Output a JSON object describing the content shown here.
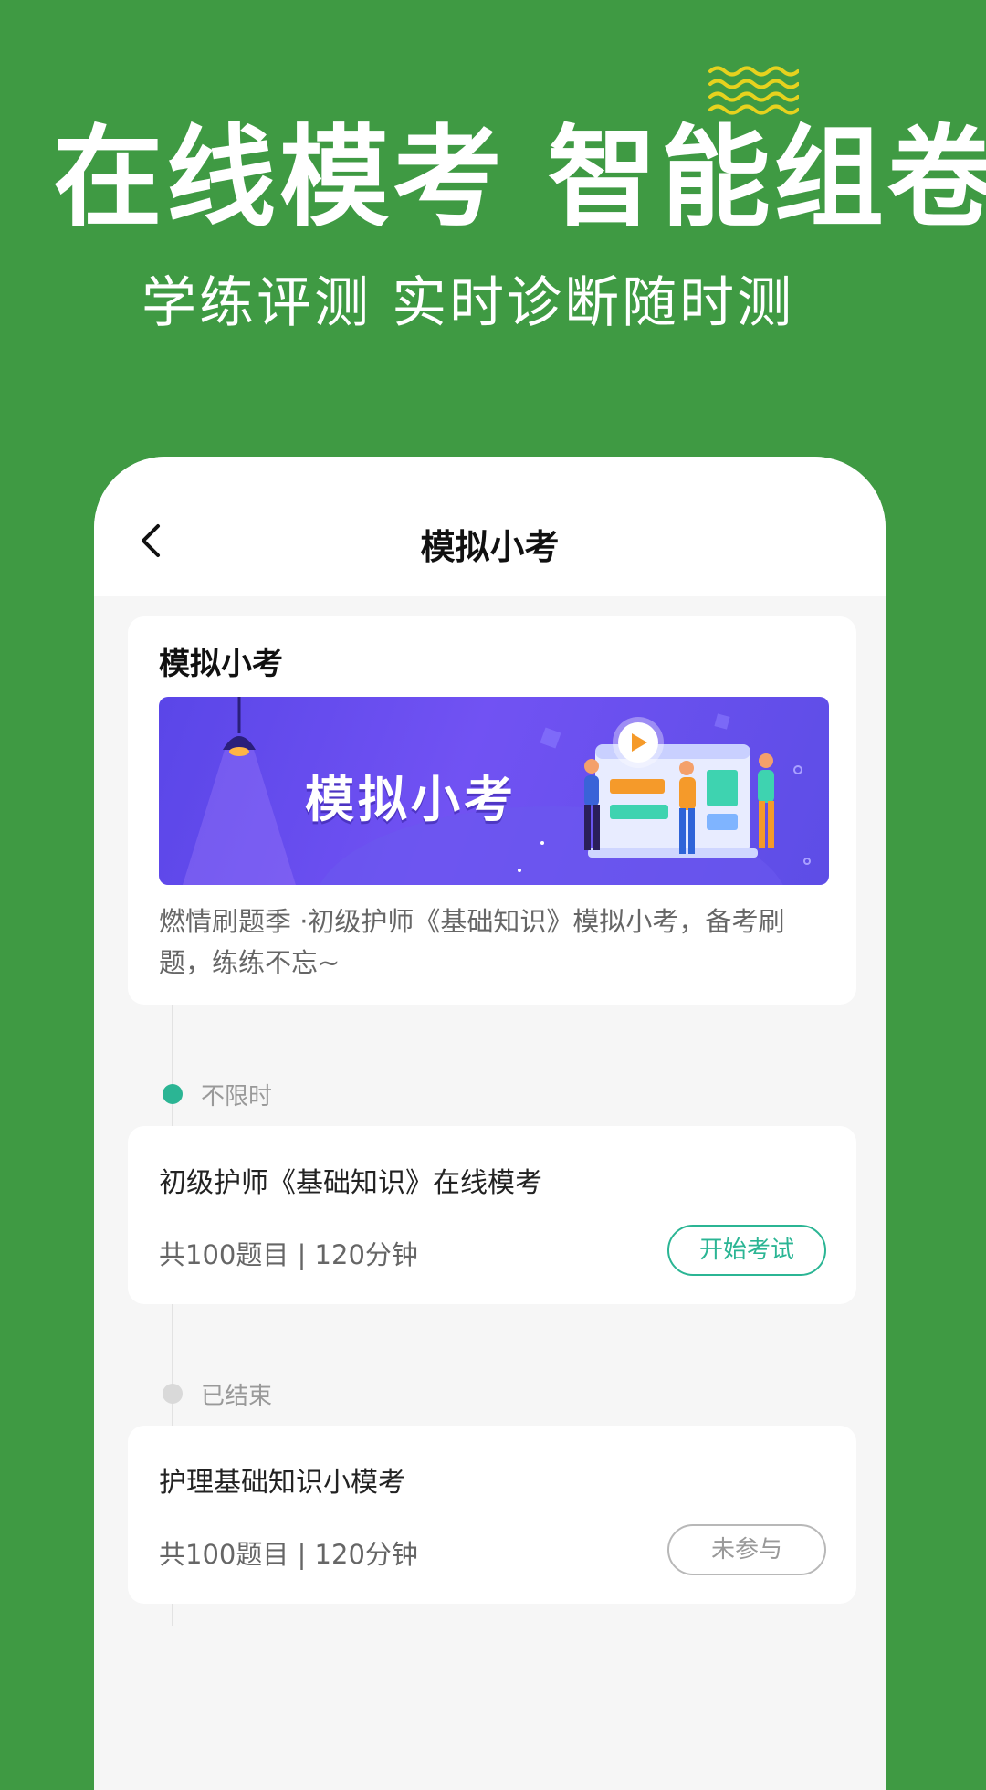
{
  "promo": {
    "headline": "在线模考 智能组卷",
    "subheadline": "学练评测  实时诊断随时测",
    "accent_color": "#e6d21e",
    "background_color": "#3f9a43"
  },
  "nav": {
    "back_icon": "chevron-left-icon",
    "title": "模拟小考"
  },
  "intro": {
    "title": "模拟小考",
    "banner_text": "模拟小考",
    "description": "燃情刷题季 ·初级护师《基础知识》模拟小考，备考刷题，练练不忘~"
  },
  "sections": [
    {
      "label": "不限时",
      "status_color": "#2bb594",
      "exam": {
        "title": "初级护师《基础知识》在线模考",
        "meta": "共100题目 | 120分钟",
        "button": "开始考试"
      }
    },
    {
      "label": "已结束",
      "status_color": "#d9d9d9",
      "exam": {
        "title": "护理基础知识小模考",
        "meta": "共100题目 | 120分钟",
        "button": "未参与"
      }
    }
  ]
}
